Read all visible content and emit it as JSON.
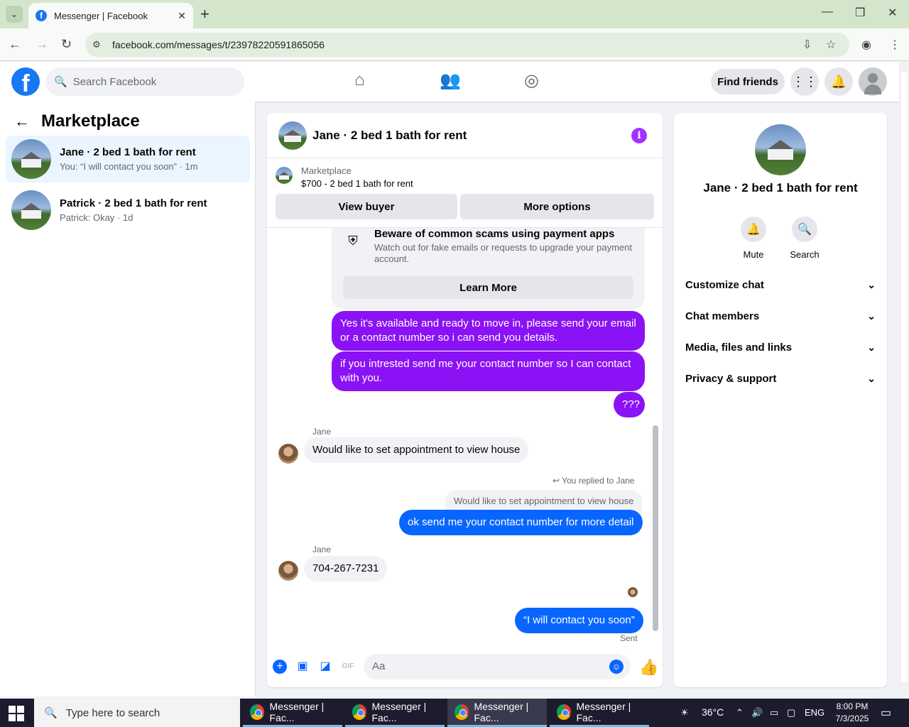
{
  "browser": {
    "tab_title": "Messenger | Facebook",
    "url": "facebook.com/messages/t/23978220591865056"
  },
  "fb": {
    "search_placeholder": "Search Facebook",
    "find_friends": "Find friends",
    "brand_color": "#1877f2"
  },
  "left": {
    "title": "Marketplace",
    "conversations": [
      {
        "name": "Jane · 2 bed 1 bath for rent",
        "preview": "You: “I will contact you soon” · 1m"
      },
      {
        "name": "Patrick · 2 bed 1 bath for rent",
        "preview": "Patrick: Okay · 1d"
      }
    ]
  },
  "chat": {
    "title": "Jane · 2 bed 1 bath for rent",
    "marketplace_label": "Marketplace",
    "listing": "$700 - 2 bed 1 bath for rent",
    "view_buyer": "View buyer",
    "more_options": "More options",
    "scam_title": "Beware of common scams using payment apps",
    "scam_text": "Watch out for fake emails or requests to upgrade your payment account.",
    "learn_more": "Learn More",
    "messages": {
      "m1": "Yes it's available and ready to move in, please send your email or a contact number so i can send you details.",
      "m2": "if you intrested send me your contact number so I can contact with you.",
      "m3": "???",
      "jane_label_1": "Jane",
      "m4": "Would like to set appointment to view house",
      "reply_label": "You replied to Jane",
      "replied_quote": "Would like to set appointment to view house",
      "m5": "ok send me your contact number for more detail",
      "jane_label_2": "Jane",
      "m6": "704-267-7231",
      "m7": "“I will contact you soon”",
      "sent": "Sent"
    },
    "composer_placeholder": "Aa",
    "accent_purple": "#8a12f5",
    "accent_blue": "#0866ff"
  },
  "right": {
    "name": "Jane · 2 bed 1 bath for rent",
    "mute": "Mute",
    "search": "Search",
    "sections": [
      "Customize chat",
      "Chat members",
      "Media, files and links",
      "Privacy & support"
    ]
  },
  "taskbar": {
    "search_placeholder": "Type here to search",
    "apps": [
      "Messenger | Fac...",
      "Messenger | Fac...",
      "Messenger | Fac...",
      "Messenger | Fac..."
    ],
    "temperature": "36°C",
    "lang": "ENG",
    "time": "8:00 PM",
    "date": "7/3/2025"
  }
}
